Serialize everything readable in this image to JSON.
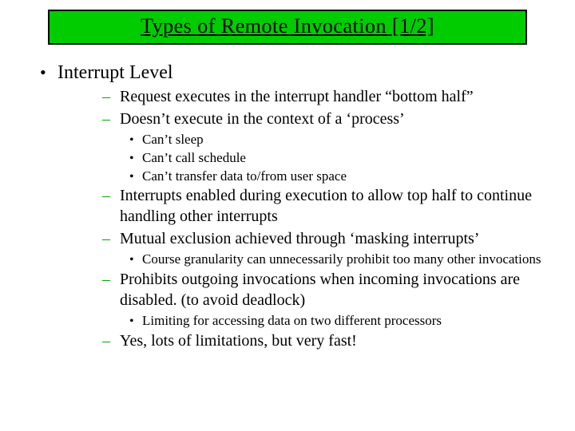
{
  "title": "Types of Remote Invocation  [1/2]",
  "heading": "Interrupt Level",
  "points": [
    {
      "text": "Request executes in the interrupt handler “bottom half”",
      "sub": []
    },
    {
      "text": "Doesn’t execute in the context of a ‘process’",
      "sub": [
        "Can’t sleep",
        "Can’t call schedule",
        "Can’t transfer data to/from user space"
      ]
    },
    {
      "text": "Interrupts enabled during execution to allow top half to continue handling other interrupts",
      "sub": []
    },
    {
      "text": "Mutual exclusion achieved through ‘masking interrupts’",
      "sub": [
        "Course granularity can unnecessarily prohibit too many other invocations"
      ]
    },
    {
      "text": "Prohibits outgoing invocations when incoming invocations are disabled. (to avoid deadlock)",
      "sub": [
        "Limiting for accessing data on two different processors"
      ]
    },
    {
      "text": "Yes, lots of limitations, but very fast!",
      "sub": []
    }
  ]
}
